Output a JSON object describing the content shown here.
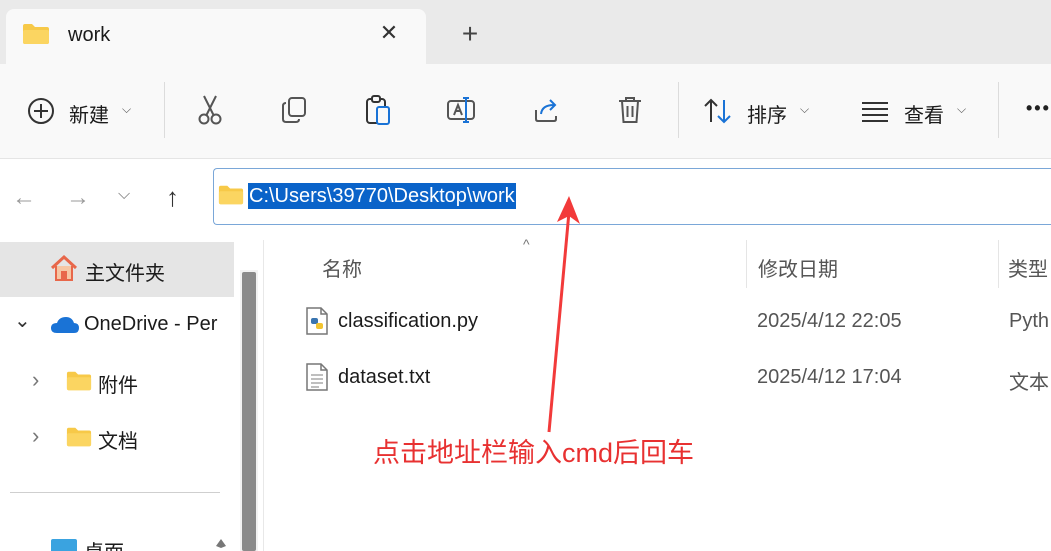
{
  "tab": {
    "title": "work",
    "close": "✕",
    "new": "+"
  },
  "toolbar": {
    "new_label": "新建",
    "sort_label": "排序",
    "view_label": "查看",
    "more": "•••",
    "chevron": "⌵"
  },
  "nav": {
    "back": "←",
    "forward": "→",
    "recent": "⌵",
    "up": "↑"
  },
  "address": {
    "path": "C:\\Users\\39770\\Desktop\\work"
  },
  "sidebar": {
    "items": [
      {
        "label": "主文件夹"
      },
      {
        "label": "OneDrive - Per"
      },
      {
        "label": "附件"
      },
      {
        "label": "文档"
      },
      {
        "label": "桌面"
      }
    ],
    "expand": "›",
    "collapse": "⌄"
  },
  "columns": {
    "name": "名称",
    "modified": "修改日期",
    "type": "类型",
    "sort_arrow": "^"
  },
  "files": [
    {
      "name": "classification.py",
      "date": "2025/4/12 22:05",
      "type": "Pyth"
    },
    {
      "name": "dataset.txt",
      "date": "2025/4/12 17:04",
      "type": "文本"
    }
  ],
  "annotation": {
    "text": "点击地址栏输入cmd后回车",
    "color": "#e83131"
  },
  "colors": {
    "accent": "#0a63c9",
    "folder": "#f7c948"
  }
}
